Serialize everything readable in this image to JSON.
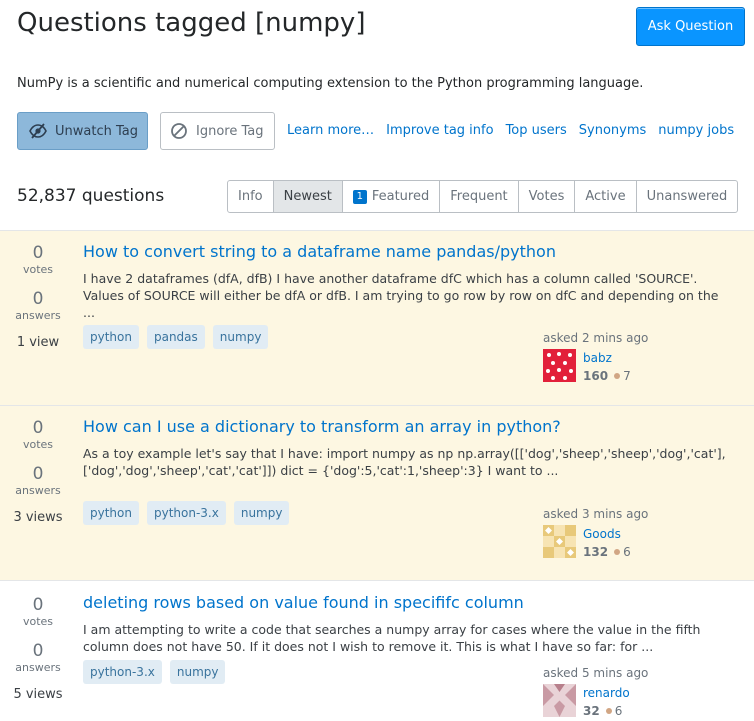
{
  "header": {
    "title": "Questions tagged [numpy]",
    "ask_button": "Ask Question"
  },
  "tag_description": "NumPy is a scientific and numerical computing extension to the Python programming language.",
  "actions": {
    "unwatch": "Unwatch Tag",
    "ignore": "Ignore Tag",
    "links": [
      "Learn more…",
      "Improve tag info",
      "Top users",
      "Synonyms",
      "numpy jobs"
    ]
  },
  "question_count": "52,837 questions",
  "tabs": {
    "info": "Info",
    "newest": "Newest",
    "featured_badge": "1",
    "featured": "Featured",
    "frequent": "Frequent",
    "votes": "Votes",
    "active": "Active",
    "unanswered": "Unanswered",
    "selected": "Newest"
  },
  "questions": [
    {
      "votes": "0",
      "votes_label": "votes",
      "answers": "0",
      "answers_label": "answers",
      "views": "1 view",
      "title": "How to convert string to a dataframe name pandas/python",
      "excerpt": "I have 2 dataframes (dfA, dfB) I have another dataframe dfC which has a column called 'SOURCE'. Values of SOURCE will either be dfA or dfB. I am trying to go row by row on dfC and depending on the ...",
      "tags": [
        "python",
        "pandas",
        "numpy"
      ],
      "asked": "asked 2 mins ago",
      "user": "babz",
      "rep": "160",
      "bronze": "7",
      "avatar_color": "#e2203a"
    },
    {
      "votes": "0",
      "votes_label": "votes",
      "answers": "0",
      "answers_label": "answers",
      "views": "3 views",
      "title": "How can I use a dictionary to transform an array in python?",
      "excerpt": "As a toy example let's say that I have: import numpy as np np.array([['dog','sheep','sheep','dog','cat'], ['dog','dog','sheep','cat','cat']]) dict = {'dog':5,'cat':1,'sheep':3} I want to ...",
      "tags": [
        "python",
        "python-3.x",
        "numpy"
      ],
      "asked": "asked 3 mins ago",
      "user": "Goods",
      "rep": "132",
      "bronze": "6",
      "avatar_color": "#e8c97a"
    },
    {
      "votes": "0",
      "votes_label": "votes",
      "answers": "0",
      "answers_label": "answers",
      "views": "5 views",
      "title": "deleting rows based on value found in specififc column",
      "excerpt": "I am attempting to write a code that searches a numpy array for cases where the value in the fifth column does not have 50. If it does not I wish to remove it. This is what I have so far: for ...",
      "tags": [
        "python-3.x",
        "numpy"
      ],
      "asked": "asked 5 mins ago",
      "user": "renardo",
      "rep": "32",
      "bronze": "6",
      "avatar_color": "#c99aa4"
    }
  ]
}
